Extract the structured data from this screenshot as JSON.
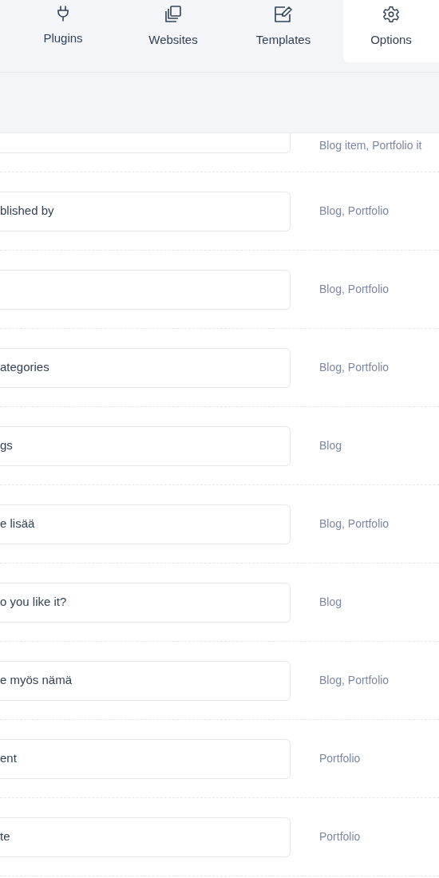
{
  "tabs": [
    {
      "label": "Plugins",
      "kind": "plug",
      "selected": false
    },
    {
      "label": "Websites",
      "kind": "copy",
      "selected": false
    },
    {
      "label": "Templates",
      "kind": "edit",
      "selected": false
    },
    {
      "label": "Options",
      "kind": "gear",
      "selected": true
    }
  ],
  "rows": [
    {
      "usage": "Blog item, Portfolio it"
    },
    {
      "value": "blished by",
      "usage": "Blog, Portfolio"
    },
    {
      "usage": "Blog, Portfolio"
    },
    {
      "value": "ategories",
      "usage": "Blog, Portfolio"
    },
    {
      "value": "gs",
      "usage": "Blog"
    },
    {
      "value": "e lisää",
      "usage": "Blog, Portfolio"
    },
    {
      "value": "o you like it?",
      "usage": "Blog"
    },
    {
      "value": "e myös nämä",
      "usage": "Blog, Portfolio"
    },
    {
      "value": "ent",
      "usage": "Portfolio"
    },
    {
      "value": "te",
      "usage": "Portfolio"
    }
  ]
}
